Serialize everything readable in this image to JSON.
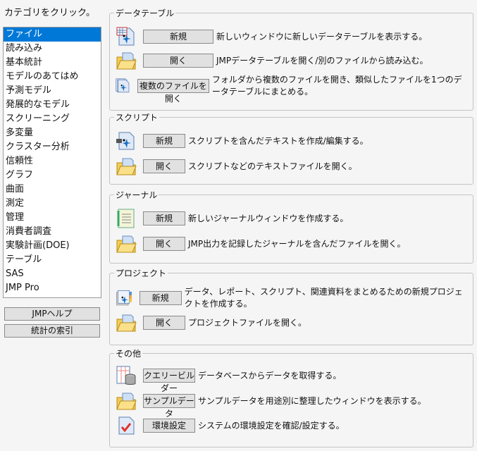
{
  "prompt": "カテゴリをクリック。",
  "categories": [
    "ファイル",
    "読み込み",
    "基本統計",
    "モデルのあてはめ",
    "予測モデル",
    "発展的なモデル",
    "スクリーニング",
    "多変量",
    "クラスター分析",
    "信頼性",
    "グラフ",
    "曲面",
    "測定",
    "管理",
    "消費者調査",
    "実験計画(DOE)",
    "テーブル",
    "SAS",
    "JMP Pro"
  ],
  "selected_category": "ファイル",
  "left_buttons": {
    "help": "JMPヘルプ",
    "index": "統計の索引"
  },
  "groups": [
    {
      "title": "データテーブル",
      "rows": [
        {
          "icon": "new-data-table-icon",
          "button": "新規",
          "desc": "新しいウィンドウに新しいデータテーブルを表示する。"
        },
        {
          "icon": "open-folder-icon",
          "button": "開く",
          "desc": "JMPデータテーブルを開く/別のファイルから読み込む。"
        },
        {
          "icon": "multiple-files-icon",
          "button": "複数のファイルを開く",
          "desc": "フォルダから複数のファイルを開き、類似したファイルを1つのデータテーブルにまとめる。"
        }
      ]
    },
    {
      "title": "スクリプト",
      "rows": [
        {
          "icon": "new-script-icon",
          "button": "新規",
          "desc": "スクリプトを含んだテキストを作成/編集する。"
        },
        {
          "icon": "open-folder-icon",
          "button": "開く",
          "desc": "スクリプトなどのテキストファイルを開く。"
        }
      ]
    },
    {
      "title": "ジャーナル",
      "rows": [
        {
          "icon": "new-journal-icon",
          "button": "新規",
          "desc": "新しいジャーナルウィンドウを作成する。"
        },
        {
          "icon": "open-folder-icon",
          "button": "開く",
          "desc": "JMP出力を記録したジャーナルを含んだファイルを開く。"
        }
      ]
    },
    {
      "title": "プロジェクト",
      "rows": [
        {
          "icon": "new-project-icon",
          "button": "新規",
          "desc": "データ、レポート、スクリプト、関連資料をまとめるための新規プロジェクトを作成する。"
        },
        {
          "icon": "open-folder-icon",
          "button": "開く",
          "desc": "プロジェクトファイルを開く。"
        }
      ]
    },
    {
      "title": "その他",
      "rows": [
        {
          "icon": "query-builder-icon",
          "button": "クエリービルダー",
          "desc": "データベースからデータを取得する。"
        },
        {
          "icon": "sample-data-folder-icon",
          "button": "サンプルデータ",
          "desc": "サンプルデータを用途別に整理したウィンドウを表示する。"
        },
        {
          "icon": "preferences-checklist-icon",
          "button": "環境設定",
          "desc": "システムの環境設定を確認/設定する。"
        }
      ]
    }
  ],
  "colors": {
    "selection": "#0078d7"
  }
}
